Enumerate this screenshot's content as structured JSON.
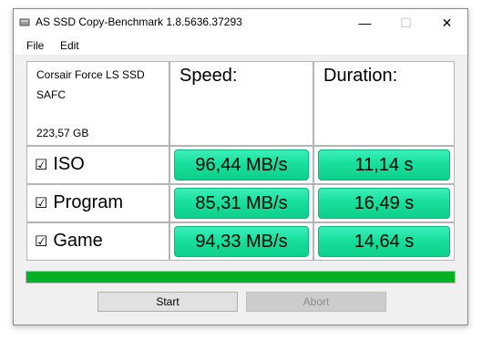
{
  "window": {
    "title": "AS SSD Copy-Benchmark 1.8.5636.37293",
    "minimize": "—",
    "maximize": "☐",
    "close": "✕"
  },
  "menu": {
    "file": "File",
    "edit": "Edit"
  },
  "drive": {
    "name": "Corsair Force LS SSD",
    "firmware": "SAFC",
    "size": "223,57 GB"
  },
  "headers": {
    "speed": "Speed:",
    "duration": "Duration:"
  },
  "rows": [
    {
      "label": "ISO",
      "checked": "☑",
      "speed": "96,44 MB/s",
      "duration": "11,14 s"
    },
    {
      "label": "Program",
      "checked": "☑",
      "speed": "85,31 MB/s",
      "duration": "16,49 s"
    },
    {
      "label": "Game",
      "checked": "☑",
      "speed": "94,33 MB/s",
      "duration": "14,64 s"
    }
  ],
  "progress": {
    "value_percent": 100,
    "color": "#06b025"
  },
  "buttons": {
    "start": "Start",
    "abort": "Abort"
  },
  "colors": {
    "result_green": "#18df9d"
  }
}
